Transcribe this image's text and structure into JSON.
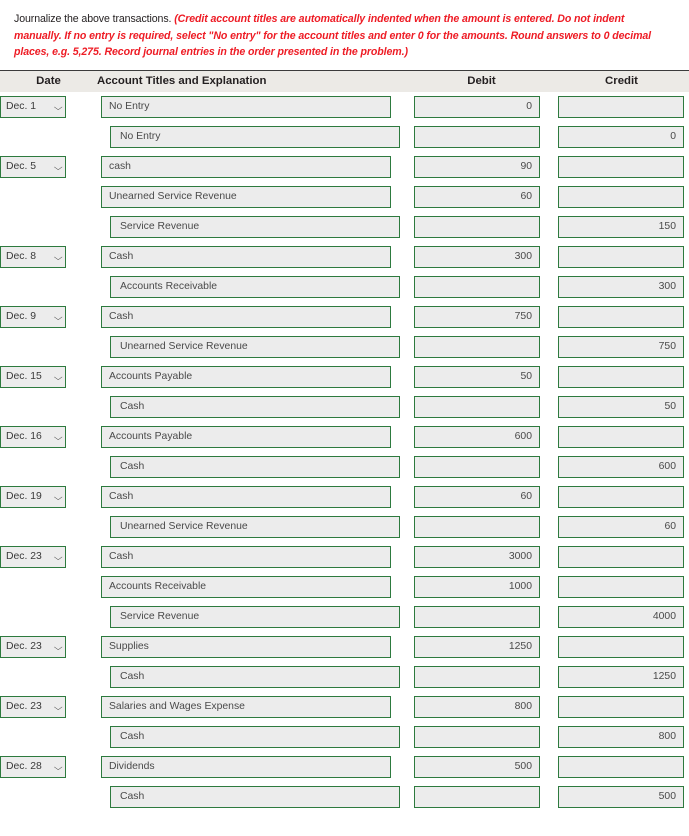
{
  "instructions": {
    "lead": "Journalize the above transactions.",
    "note": "(Credit account titles are automatically indented when the amount is entered. Do not indent manually. If no entry is required, select \"No entry\" for the account titles and enter 0 for the amounts. Round answers to 0 decimal places, e.g. 5,275. Record journal entries in the order presented in the problem.)"
  },
  "colors": {
    "accent_border": "#2d7a3e",
    "field_background": "#ececec",
    "header_background": "#eceae6",
    "note_red": "#ee1c25"
  },
  "table": {
    "headers": {
      "date": "Date",
      "account": "Account Titles and Explanation",
      "debit": "Debit",
      "credit": "Credit"
    },
    "chevron_glyph": "⌵",
    "rows": [
      {
        "date": "Dec. 1",
        "account": "No Entry",
        "indent": false,
        "debit": "0",
        "credit": ""
      },
      {
        "date": "",
        "account": "No Entry",
        "indent": true,
        "debit": "",
        "credit": "0"
      },
      {
        "date": "Dec. 5",
        "account": "cash",
        "indent": false,
        "debit": "90",
        "credit": ""
      },
      {
        "date": "",
        "account": "Unearned Service Revenue",
        "indent": false,
        "debit": "60",
        "credit": ""
      },
      {
        "date": "",
        "account": "Service Revenue",
        "indent": true,
        "debit": "",
        "credit": "150"
      },
      {
        "date": "Dec. 8",
        "account": "Cash",
        "indent": false,
        "debit": "300",
        "credit": ""
      },
      {
        "date": "",
        "account": "Accounts Receivable",
        "indent": true,
        "debit": "",
        "credit": "300"
      },
      {
        "date": "Dec. 9",
        "account": "Cash",
        "indent": false,
        "debit": "750",
        "credit": ""
      },
      {
        "date": "",
        "account": "Unearned Service Revenue",
        "indent": true,
        "debit": "",
        "credit": "750"
      },
      {
        "date": "Dec. 15",
        "account": "Accounts Payable",
        "indent": false,
        "debit": "50",
        "credit": ""
      },
      {
        "date": "",
        "account": "Cash",
        "indent": true,
        "debit": "",
        "credit": "50"
      },
      {
        "date": "Dec. 16",
        "account": "Accounts Payable",
        "indent": false,
        "debit": "600",
        "credit": ""
      },
      {
        "date": "",
        "account": "Cash",
        "indent": true,
        "debit": "",
        "credit": "600"
      },
      {
        "date": "Dec. 19",
        "account": "Cash",
        "indent": false,
        "debit": "60",
        "credit": ""
      },
      {
        "date": "",
        "account": "Unearned Service Revenue",
        "indent": true,
        "debit": "",
        "credit": "60"
      },
      {
        "date": "Dec. 23",
        "account": "Cash",
        "indent": false,
        "debit": "3000",
        "credit": ""
      },
      {
        "date": "",
        "account": "Accounts Receivable",
        "indent": false,
        "debit": "1000",
        "credit": ""
      },
      {
        "date": "",
        "account": "Service Revenue",
        "indent": true,
        "debit": "",
        "credit": "4000"
      },
      {
        "date": "Dec. 23",
        "account": "Supplies",
        "indent": false,
        "debit": "1250",
        "credit": ""
      },
      {
        "date": "",
        "account": "Cash",
        "indent": true,
        "debit": "",
        "credit": "1250"
      },
      {
        "date": "Dec. 23",
        "account": "Salaries and Wages Expense",
        "indent": false,
        "debit": "800",
        "credit": ""
      },
      {
        "date": "",
        "account": "Cash",
        "indent": true,
        "debit": "",
        "credit": "800"
      },
      {
        "date": "Dec. 28",
        "account": "Dividends",
        "indent": false,
        "debit": "500",
        "credit": ""
      },
      {
        "date": "",
        "account": "Cash",
        "indent": true,
        "debit": "",
        "credit": "500"
      }
    ]
  }
}
